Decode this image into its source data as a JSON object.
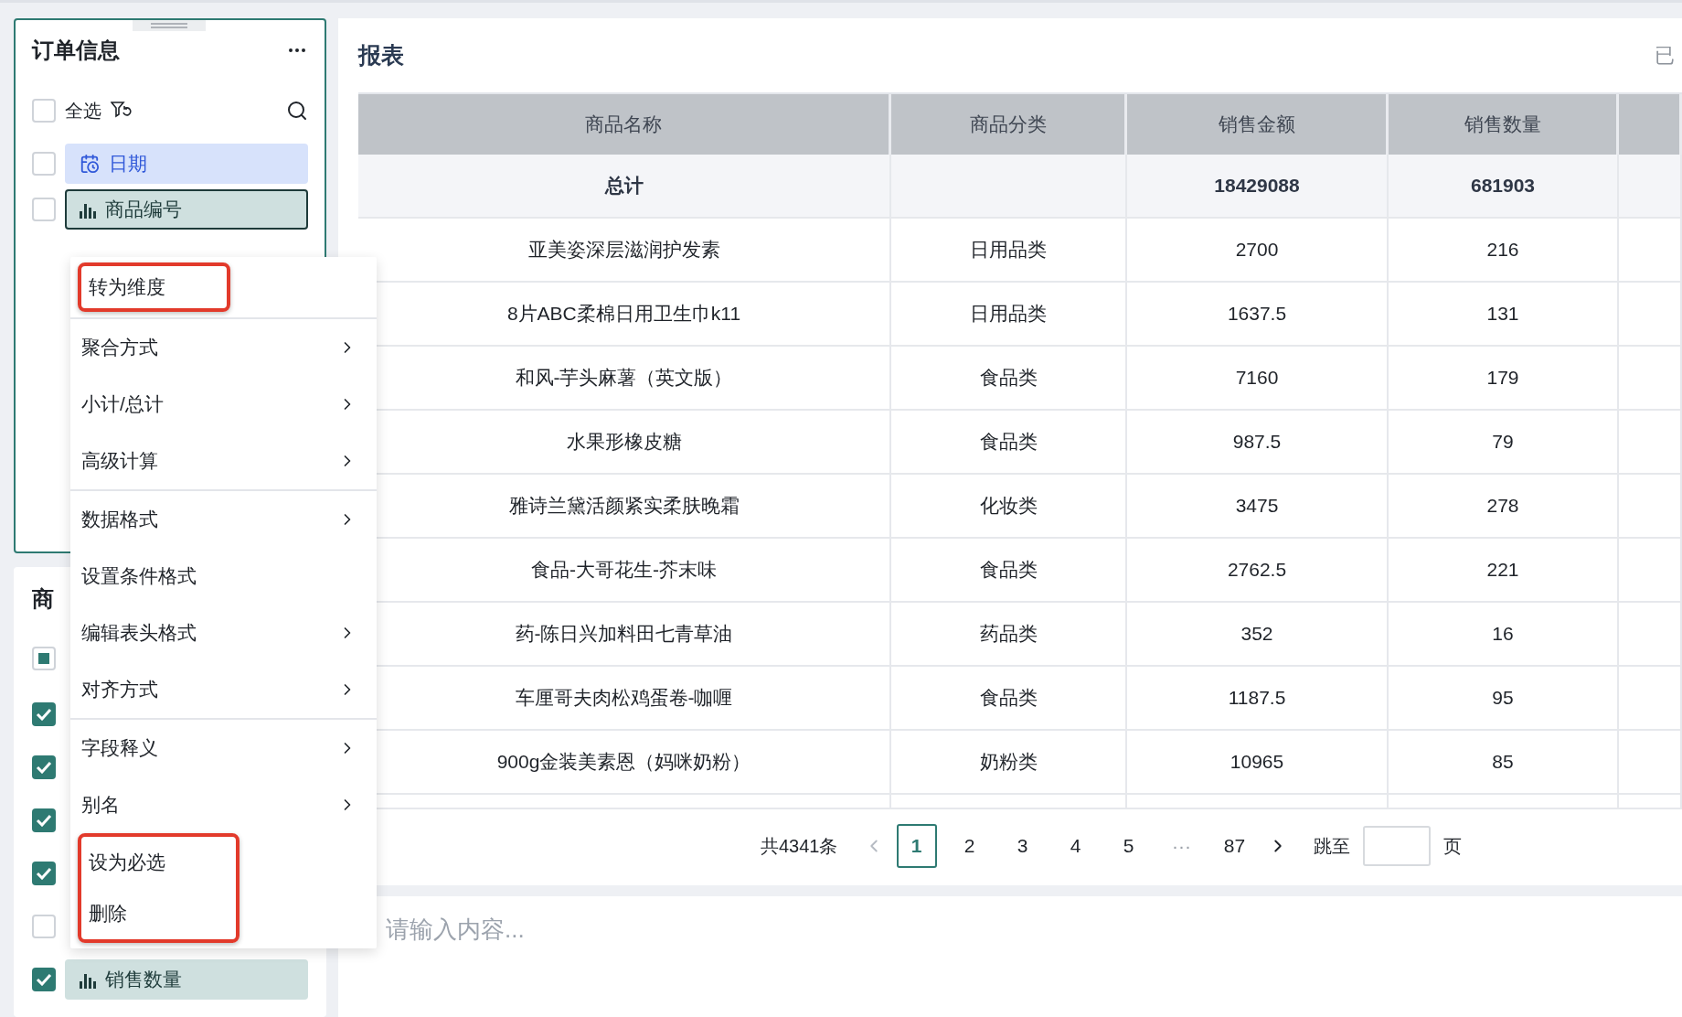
{
  "order_panel": {
    "title": "订单信息",
    "select_all": {
      "label": "全选",
      "checked": false
    },
    "fields": [
      {
        "label": "日期",
        "kind": "date",
        "checked": false,
        "selected": false
      },
      {
        "label": "商品编号",
        "kind": "measure",
        "checked": false,
        "selected": true
      }
    ]
  },
  "product_panel": {
    "title": "商",
    "select_all": {
      "indeterminate": true
    },
    "fields": [
      {
        "checked": true
      },
      {
        "checked": true
      },
      {
        "checked": true
      },
      {
        "checked": true
      },
      {
        "checked": false
      },
      {
        "checked": true,
        "label": "销售数量",
        "kind": "measure"
      }
    ]
  },
  "context_menu": {
    "groups": [
      [
        {
          "label": "转为维度",
          "submenu": false,
          "highlighted": true
        }
      ],
      [
        {
          "label": "聚合方式",
          "submenu": true,
          "highlighted": false
        },
        {
          "label": "小计/总计",
          "submenu": true,
          "highlighted": false
        },
        {
          "label": "高级计算",
          "submenu": true,
          "highlighted": false
        }
      ],
      [
        {
          "label": "数据格式",
          "submenu": true,
          "highlighted": false
        },
        {
          "label": "设置条件格式",
          "submenu": false,
          "highlighted": false
        },
        {
          "label": "编辑表头格式",
          "submenu": true,
          "highlighted": false
        },
        {
          "label": "对齐方式",
          "submenu": true,
          "highlighted": false
        }
      ],
      [
        {
          "label": "字段释义",
          "submenu": true,
          "highlighted": false
        },
        {
          "label": "别名",
          "submenu": true,
          "highlighted": false
        },
        {
          "label": "设为必选",
          "submenu": false,
          "highlighted": true
        },
        {
          "label": "删除",
          "submenu": false,
          "highlighted": true
        }
      ]
    ]
  },
  "report": {
    "title": "报表",
    "header_right": "已",
    "table": {
      "columns": [
        "商品名称",
        "商品分类",
        "销售金额",
        "销售数量"
      ],
      "total": {
        "name": "总计",
        "amount": "18429088",
        "quantity": "681903"
      },
      "rows": [
        {
          "name": "亚美姿深层滋润护发素",
          "category": "日用品类",
          "amount": "2700",
          "quantity": "216"
        },
        {
          "name": "8片ABC柔棉日用卫生巾k11",
          "category": "日用品类",
          "amount": "1637.5",
          "quantity": "131"
        },
        {
          "name": "和风-芋头麻薯（英文版）",
          "category": "食品类",
          "amount": "7160",
          "quantity": "179"
        },
        {
          "name": "水果形橡皮糖",
          "category": "食品类",
          "amount": "987.5",
          "quantity": "79"
        },
        {
          "name": "雅诗兰黛活颜紧实柔肤晚霜",
          "category": "化妆类",
          "amount": "3475",
          "quantity": "278"
        },
        {
          "name": "食品-大哥花生-芥末味",
          "category": "食品类",
          "amount": "2762.5",
          "quantity": "221"
        },
        {
          "name": "药-陈日兴加料田七青草油",
          "category": "药品类",
          "amount": "352",
          "quantity": "16"
        },
        {
          "name": "车厘哥夫肉松鸡蛋卷-咖喱",
          "category": "食品类",
          "amount": "1187.5",
          "quantity": "95"
        },
        {
          "name": "900g金装美素恩（妈咪奶粉）",
          "category": "奶粉类",
          "amount": "10965",
          "quantity": "85"
        }
      ]
    },
    "pagination": {
      "total": "共4341条",
      "prev_disabled": true,
      "pages": [
        {
          "label": "1",
          "kind": "page",
          "selected": true
        },
        {
          "label": "2",
          "kind": "page",
          "selected": false
        },
        {
          "label": "3",
          "kind": "page",
          "selected": false
        },
        {
          "label": "4",
          "kind": "page",
          "selected": false
        },
        {
          "label": "5",
          "kind": "page",
          "selected": false
        },
        {
          "label": "···",
          "kind": "ellipsis"
        },
        {
          "label": "87",
          "kind": "page",
          "selected": false
        }
      ],
      "jump_label": "跳至",
      "jump_unit": "页"
    }
  },
  "comment": {
    "placeholder": "请输入内容..."
  }
}
